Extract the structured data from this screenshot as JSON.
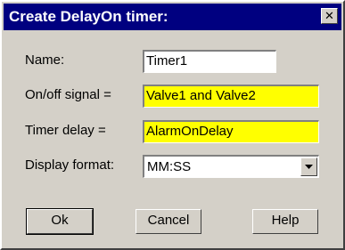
{
  "window": {
    "title": "Create DelayOn timer:",
    "close_glyph": "✕"
  },
  "form": {
    "name_label": "Name:",
    "name_value": "Timer1",
    "signal_label": "On/off signal =",
    "signal_value": "Valve1 and Valve2",
    "delay_label": "Timer delay =",
    "delay_value": "AlarmOnDelay",
    "format_label": "Display format:",
    "format_value": "MM:SS"
  },
  "buttons": {
    "ok": "Ok",
    "cancel": "Cancel",
    "help": "Help"
  },
  "colors": {
    "titlebar": "#000080",
    "dialog": "#d4d0c8",
    "highlight_field": "#ffff00"
  }
}
